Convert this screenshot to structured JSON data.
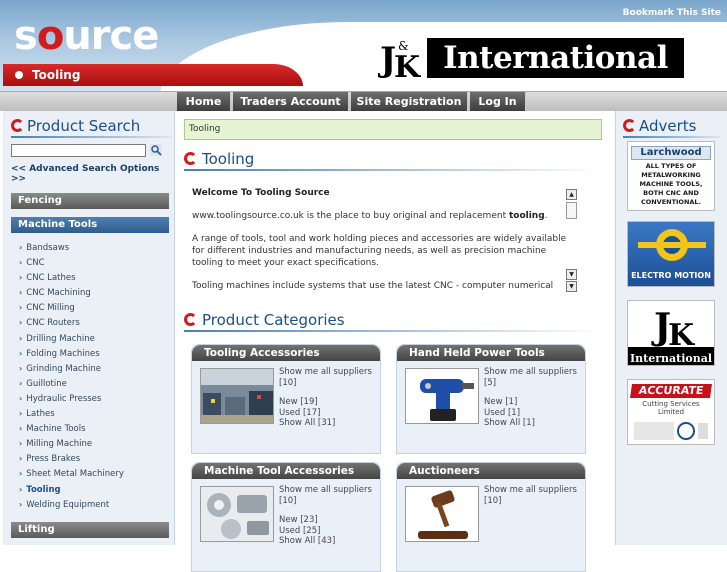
{
  "header": {
    "bookmark_label": "Bookmark This Site",
    "logo": {
      "part1": "s",
      "part2": "o",
      "part3": "urce"
    },
    "section_title": "Tooling",
    "sponsor_text": "International"
  },
  "nav": {
    "items": [
      {
        "label": "Home"
      },
      {
        "label": "Traders Account"
      },
      {
        "label": "Site Registration"
      },
      {
        "label": "Log In"
      }
    ]
  },
  "left": {
    "search_heading": "Product Search",
    "search_placeholder": "",
    "advanced_search": "<< Advanced Search Options >>",
    "categories": [
      {
        "label": "Fencing"
      },
      {
        "label": "Machine Tools"
      }
    ],
    "subcategories": [
      {
        "label": "Bandsaws"
      },
      {
        "label": "CNC"
      },
      {
        "label": "CNC Lathes"
      },
      {
        "label": "CNC Machining"
      },
      {
        "label": "CNC Milling"
      },
      {
        "label": "CNC Routers"
      },
      {
        "label": "Drilling Machine"
      },
      {
        "label": "Folding Machines"
      },
      {
        "label": "Grinding Machine"
      },
      {
        "label": "Guillotine"
      },
      {
        "label": "Hydraulic Presses"
      },
      {
        "label": "Lathes"
      },
      {
        "label": "Machine Tools"
      },
      {
        "label": "Milling Machine"
      },
      {
        "label": "Press Brakes"
      },
      {
        "label": "Sheet Metal Machinery"
      },
      {
        "label": "Tooling"
      },
      {
        "label": "Welding Equipment"
      }
    ],
    "bottom_category": "Lifting"
  },
  "center": {
    "breadcrumb": "Tooling",
    "heading": "Tooling",
    "intro": {
      "title": "Welcome To Tooling Source",
      "p1_pre": "www.toolingsource.co.uk is the place to buy original and replacement ",
      "p1_bold": "tooling",
      "p1_post": ".",
      "p2": "A range of tools, tool and work holding pieces and accessories are widely available for different industries and manufacturing needs, as well as precision machine tooling to meet your exact specifications.",
      "p3": "Tooling machines include systems that use the latest CNC - computer numerical"
    },
    "categories_heading": "Product Categories",
    "cards": [
      {
        "title": "Tooling Accessories",
        "suppliers": "Show me all suppliers",
        "suppliers_count": "[10]",
        "new": "New [19]",
        "used": "Used [17]",
        "all": "Show All [31]"
      },
      {
        "title": "Hand Held Power Tools",
        "suppliers": "Show me all suppliers",
        "suppliers_count": "[5]",
        "new": "New [1]",
        "used": "Used [1]",
        "all": "Show All [1]"
      },
      {
        "title": "Machine Tool Accessories",
        "suppliers": "Show me all suppliers",
        "suppliers_count": "[10]",
        "new": "New [23]",
        "used": "Used [25]",
        "all": "Show All [43]"
      },
      {
        "title": "Auctioneers",
        "suppliers": "Show me all suppliers",
        "suppliers_count": "[10]",
        "new": "",
        "used": "",
        "all": ""
      }
    ]
  },
  "right": {
    "heading": "Adverts",
    "ads": [
      {
        "brand": "Larchwood",
        "text": "ALL TYPES OF METALWORKING MACHINE TOOLS, BOTH CNC AND CONVENTIONAL."
      },
      {
        "brand": "ELECTRO MOTION"
      },
      {
        "brand": "International"
      },
      {
        "brand": "ACCURATE",
        "text": "Cutting Services Limited"
      }
    ]
  },
  "colors": {
    "brand_red": "#d41a1a",
    "brand_blue": "#1a4f8c",
    "nav_dark": "#454545",
    "breadcrumb_green": "#e6f4d4"
  }
}
